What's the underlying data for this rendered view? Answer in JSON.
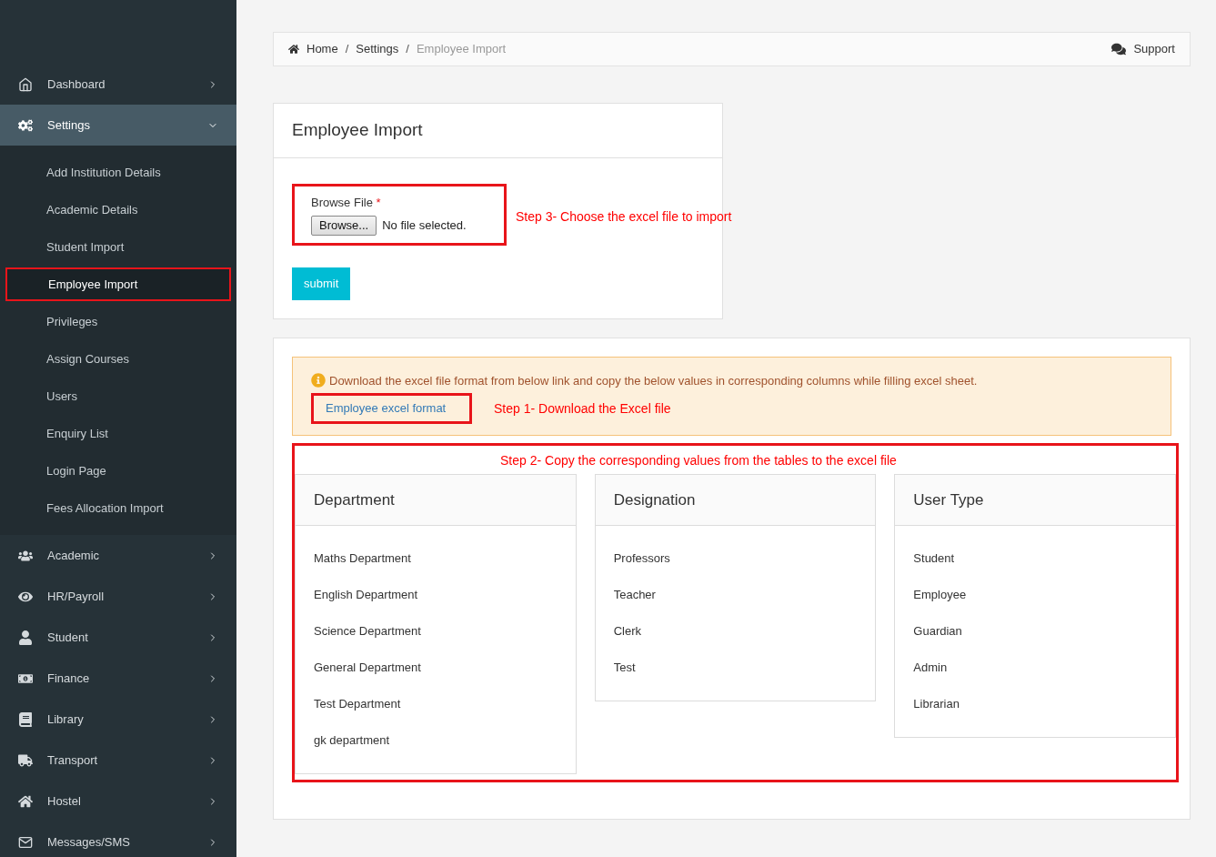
{
  "sidebar": {
    "items": [
      {
        "label": "Dashboard",
        "expanded": false
      },
      {
        "label": "Settings",
        "expanded": true,
        "children": [
          {
            "label": "Add Institution Details",
            "selected": false
          },
          {
            "label": "Academic Details",
            "selected": false
          },
          {
            "label": "Student Import",
            "selected": false
          },
          {
            "label": "Employee Import",
            "selected": true
          },
          {
            "label": "Privileges",
            "selected": false
          },
          {
            "label": "Assign Courses",
            "selected": false
          },
          {
            "label": "Users",
            "selected": false
          },
          {
            "label": "Enquiry List",
            "selected": false
          },
          {
            "label": "Login Page",
            "selected": false
          },
          {
            "label": "Fees Allocation Import",
            "selected": false
          }
        ]
      },
      {
        "label": "Academic",
        "expanded": false
      },
      {
        "label": "HR/Payroll",
        "expanded": false
      },
      {
        "label": "Student",
        "expanded": false
      },
      {
        "label": "Finance",
        "expanded": false
      },
      {
        "label": "Library",
        "expanded": false
      },
      {
        "label": "Transport",
        "expanded": false
      },
      {
        "label": "Hostel",
        "expanded": false
      },
      {
        "label": "Messages/SMS",
        "expanded": false
      }
    ]
  },
  "breadcrumb": {
    "items": [
      "Home",
      "Settings",
      "Employee Import"
    ],
    "separator": "/",
    "support": "Support"
  },
  "import_panel": {
    "title": "Employee Import",
    "field_label": "Browse File",
    "required_mark": "*",
    "browse_button": "Browse...",
    "file_status": "No file selected.",
    "submit": "submit",
    "annotation": "Step 3- Choose the excel file to import"
  },
  "info": {
    "message": "Download the excel file format from below link and copy the below values in corresponding columns while filling excel sheet.",
    "link": "Employee excel format",
    "annotation": "Step 1- Download the Excel file"
  },
  "tables_annotation": "Step 2- Copy the corresponding values from the tables to the excel file",
  "tables": [
    {
      "title": "Department",
      "rows": [
        "Maths Department",
        "English Department",
        "Science Department",
        "General Department",
        "Test Department",
        "gk department"
      ]
    },
    {
      "title": "Designation",
      "rows": [
        "Professors",
        "Teacher",
        "Clerk",
        "Test"
      ]
    },
    {
      "title": "User Type",
      "rows": [
        "Student",
        "Employee",
        "Guardian",
        "Admin",
        "Librarian"
      ]
    }
  ]
}
